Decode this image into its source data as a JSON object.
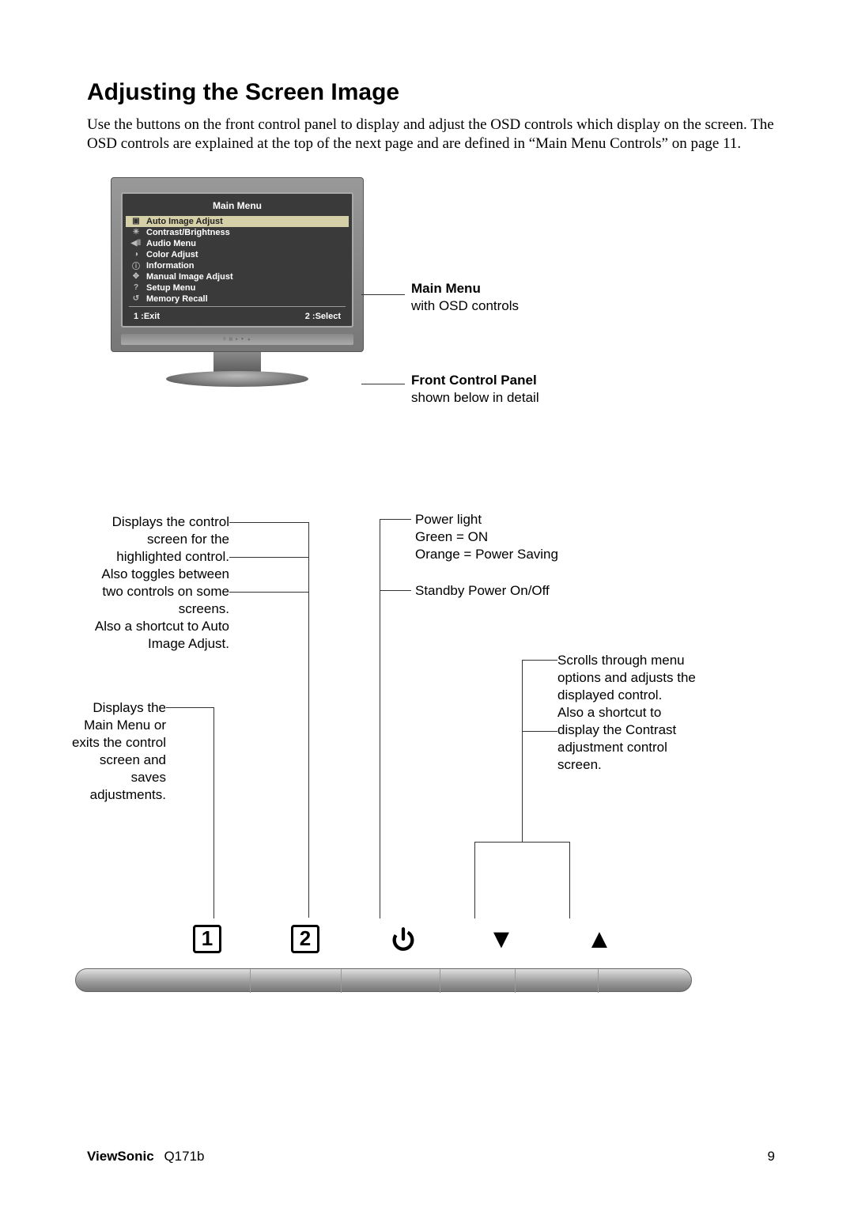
{
  "heading": "Adjusting the Screen Image",
  "intro": "Use the buttons on the front control panel to display and adjust the OSD controls which display on the screen. The OSD controls are explained at the top of the next page and are defined in “Main Menu Controls” on page 11.",
  "osd": {
    "title": "Main Menu",
    "items": [
      {
        "label": "Auto Image Adjust",
        "icon": "▣",
        "highlight": true
      },
      {
        "label": "Contrast/Brightness",
        "icon": "☀",
        "highlight": false
      },
      {
        "label": "Audio Menu",
        "icon": "◀‖",
        "highlight": false
      },
      {
        "label": "Color Adjust",
        "icon": "◑",
        "highlight": false
      },
      {
        "label": "Information",
        "icon": "ⓘ",
        "highlight": false
      },
      {
        "label": "Manual Image Adjust",
        "icon": "✥",
        "highlight": false
      },
      {
        "label": "Setup Menu",
        "icon": "?",
        "highlight": false
      },
      {
        "label": "Memory Recall",
        "icon": "↺",
        "highlight": false
      }
    ],
    "footer_left": "1 :Exit",
    "footer_right": "2 :Select"
  },
  "callouts": {
    "main_menu_title": "Main Menu",
    "main_menu_sub": "with OSD controls",
    "front_panel_title": "Front Control Panel",
    "front_panel_sub": "shown below in detail",
    "btn2_a": "Displays the control screen for the highlighted control.",
    "btn2_b": "Also toggles between two controls on some screens.",
    "btn2_c": "Also a shortcut to Auto Image Adjust.",
    "power_a": "Power light",
    "power_b": "Green = ON",
    "power_c": "Orange = Power Saving",
    "power_d": "Standby Power On/Off",
    "btn1": "Displays the Main Menu or exits the control screen and saves adjustments.",
    "arrows_a": "Scrolls through menu options and adjusts the displayed control.",
    "arrows_b": "Also a shortcut to display the Contrast adjustment control screen."
  },
  "buttons": {
    "b1": "1",
    "b2": "2"
  },
  "footer": {
    "brand": "ViewSonic",
    "model": "Q171b",
    "page": "9"
  }
}
